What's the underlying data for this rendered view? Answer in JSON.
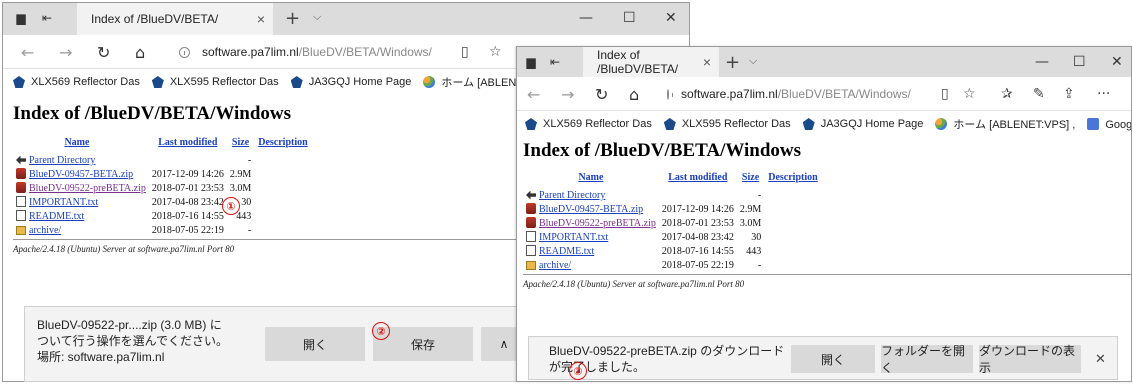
{
  "window1": {
    "tab_title": "Index of /BlueDV/BETA/",
    "tab_close": "×",
    "new_tab": "+",
    "tab_menu": "⌵",
    "win_min": "—",
    "win_max": "☐",
    "win_close": "✕",
    "nav_back": "←",
    "nav_forward": "→",
    "nav_refresh": "↻",
    "nav_home": "⌂",
    "address_host": "software.pa7lim.nl",
    "address_path": "/BlueDV/BETA/Windows/",
    "reading_view": "▯",
    "favorite": "☆",
    "favorites": [
      "XLX569 Reflector Das",
      "XLX595 Reflector Das",
      "JA3GQJ Home Page",
      "ホーム [ABLENET:VPS] ,"
    ],
    "page_title": "Index of /BlueDV/BETA/Windows",
    "server_sig": "Apache/2.4.18 (Ubuntu) Server at software.pa7lim.nl Port 80",
    "download": {
      "text_line1": "BlueDV-09522-pr....zip (3.0 MB) に",
      "text_line2": "ついて行う操作を選んでください。",
      "text_line3": "場所: software.pa7lim.nl",
      "open": "開く",
      "save": "保存",
      "expand": "∧"
    }
  },
  "window2": {
    "tab_title": "Index of /BlueDV/BETA/",
    "tab_close": "×",
    "new_tab": "+",
    "tab_menu": "⌵",
    "win_min": "—",
    "win_max": "☐",
    "win_close": "✕",
    "nav_back": "←",
    "nav_forward": "→",
    "nav_refresh": "↻",
    "nav_home": "⌂",
    "address_host": "software.pa7lim.nl",
    "address_path": "/BlueDV/BETA/Windows/",
    "reading_view": "▯",
    "favorite": "☆",
    "favorites_hub": "✰",
    "notes": "✎",
    "share": "⇪",
    "more": "···",
    "favorites": [
      "XLX569 Reflector Das",
      "XLX595 Reflector Das",
      "JA3GQJ Home Page",
      "ホーム [ABLENET:VPS] ,",
      "Google 翻訳"
    ],
    "page_title": "Index of /BlueDV/BETA/Windows",
    "server_sig": "Apache/2.4.18 (Ubuntu) Server at software.pa7lim.nl Port 80",
    "download": {
      "text_line1": "BlueDV-09522-preBETA.zip のダウンロード",
      "text_line2": "が完了しました。",
      "open": "開く",
      "open_folder": "フォルダーを開く",
      "show_downloads": "ダウンロードの表示",
      "close": "✕"
    }
  },
  "listing": {
    "headers": [
      "Name",
      "Last modified",
      "Size",
      "Description"
    ],
    "rows": [
      {
        "name": "Parent Directory",
        "modified": "",
        "size": "-",
        "icon": "back-icon"
      },
      {
        "name": "BlueDV-09457-BETA.zip",
        "modified": "2017-12-09 14:26",
        "size": "2.9M",
        "icon": "zip-icon"
      },
      {
        "name": "BlueDV-09522-preBETA.zip",
        "modified": "2018-07-01 23:53",
        "size": "3.0M",
        "icon": "zip-icon"
      },
      {
        "name": "IMPORTANT.txt",
        "modified": "2017-04-08 23:42",
        "size": "30",
        "icon": "text-file-icon"
      },
      {
        "name": "README.txt",
        "modified": "2018-07-16 14:55",
        "size": "443",
        "icon": "text-file-icon"
      },
      {
        "name": "archive/",
        "modified": "2018-07-05 22:19",
        "size": "-",
        "icon": "folder-icon"
      }
    ]
  },
  "markers": [
    "①",
    "②",
    "③"
  ],
  "colors": {
    "marker": "#e01010",
    "link": "#1a3fbf",
    "visited_link": "#7b2f8f",
    "tab_strip": "#dcdcdc"
  }
}
